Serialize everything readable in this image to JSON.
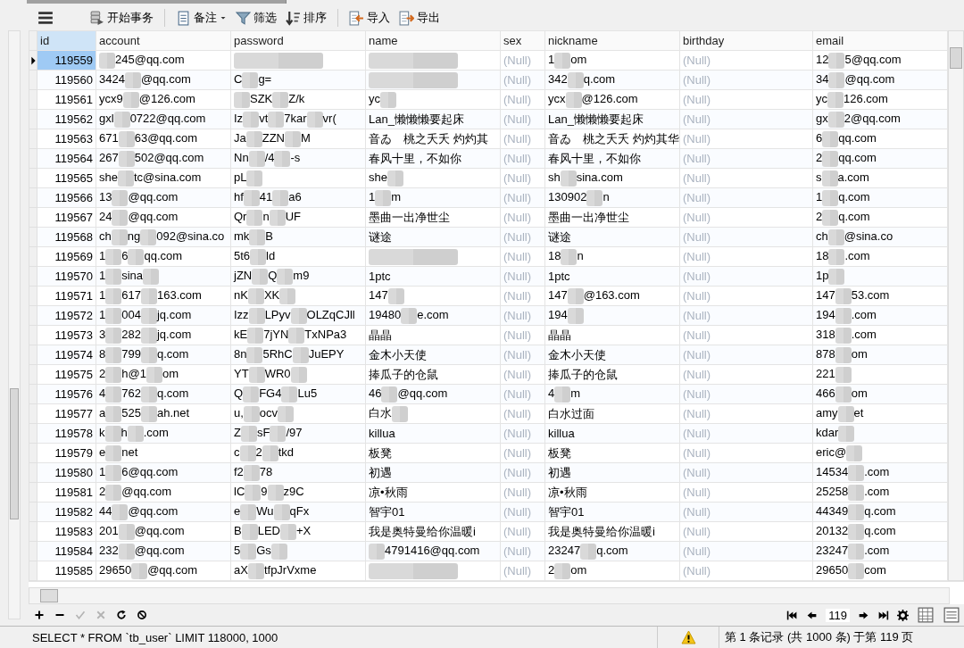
{
  "toolbar": {
    "buttons": [
      {
        "kind": "menu"
      },
      {
        "kind": "transaction",
        "label": "开始事务",
        "separator_after": true
      },
      {
        "kind": "note",
        "label": "备注",
        "dropdown": true
      },
      {
        "kind": "filter",
        "label": "筛选"
      },
      {
        "kind": "sort",
        "label": "排序",
        "separator_after": true
      },
      {
        "kind": "import",
        "label": "导入"
      },
      {
        "kind": "export",
        "label": "导出"
      }
    ]
  },
  "table": {
    "columns": [
      {
        "label": "id",
        "selected": true
      },
      {
        "label": "account",
        "selected": false
      },
      {
        "label": "password",
        "selected": false
      },
      {
        "label": "name",
        "selected": false
      },
      {
        "label": "sex",
        "selected": false
      },
      {
        "label": "nickname",
        "selected": false
      },
      {
        "label": "birthday",
        "selected": false
      },
      {
        "label": "email",
        "selected": false
      }
    ],
    "rows": [
      {
        "selected": true,
        "cells": [
          "119559",
          {
            "parts": [
              {
                "kind": "redaction"
              },
              "245@qq.com"
            ]
          },
          {
            "parts": [
              {
                "kind": "smudge"
              }
            ]
          },
          {
            "parts": [
              {
                "kind": "smudge"
              }
            ]
          },
          {
            "text": "(Null)",
            "null": true
          },
          {
            "parts": [
              "1",
              {
                "kind": "redaction"
              },
              "om"
            ]
          },
          {
            "text": "(Null)",
            "null": true
          },
          {
            "parts": [
              "12",
              {
                "kind": "redaction"
              },
              "5@qq.com"
            ]
          }
        ]
      },
      {
        "selected": false,
        "cells": [
          "119560",
          {
            "parts": [
              "3424",
              {
                "kind": "redaction"
              },
              "@qq.com"
            ]
          },
          {
            "parts": [
              "C",
              {
                "kind": "redaction"
              },
              "g="
            ]
          },
          {
            "parts": [
              {
                "kind": "smudge"
              }
            ]
          },
          {
            "text": "(Null)",
            "null": true
          },
          {
            "parts": [
              "342",
              {
                "kind": "redaction"
              },
              "q.com"
            ]
          },
          {
            "text": "(Null)",
            "null": true
          },
          {
            "parts": [
              "34",
              {
                "kind": "redaction"
              },
              "@qq.com"
            ]
          }
        ]
      },
      {
        "selected": false,
        "cells": [
          "119561",
          {
            "parts": [
              "ycx9",
              {
                "kind": "redaction"
              },
              "@126.com"
            ]
          },
          {
            "parts": [
              {
                "kind": "redaction"
              },
              "SZK",
              {
                "kind": "redaction"
              },
              "Z/k"
            ]
          },
          {
            "parts": [
              "yc",
              {
                "kind": "redaction"
              }
            ]
          },
          {
            "text": "(Null)",
            "null": true
          },
          {
            "parts": [
              "ycx",
              {
                "kind": "redaction"
              },
              "@126.com"
            ]
          },
          {
            "text": "(Null)",
            "null": true
          },
          {
            "parts": [
              "yc",
              {
                "kind": "redaction"
              },
              "126.com"
            ]
          }
        ]
      },
      {
        "selected": false,
        "cells": [
          "119562",
          {
            "parts": [
              "gxl",
              {
                "kind": "redaction"
              },
              "0722@qq.com"
            ]
          },
          {
            "parts": [
              "Iz",
              {
                "kind": "redaction"
              },
              "vt",
              {
                "kind": "redaction"
              },
              "7kar",
              {
                "kind": "redaction"
              },
              "vr("
            ]
          },
          "Lan_懒懒懒要起床",
          {
            "text": "(Null)",
            "null": true
          },
          "Lan_懒懒懒要起床",
          {
            "text": "(Null)",
            "null": true
          },
          {
            "parts": [
              "gx",
              {
                "kind": "redaction"
              },
              "2@qq.com"
            ]
          }
        ]
      },
      {
        "selected": false,
        "cells": [
          "119563",
          {
            "parts": [
              "671",
              {
                "kind": "redaction"
              },
              "63@qq.com"
            ]
          },
          {
            "parts": [
              "Ja",
              {
                "kind": "redaction"
              },
              "ZZN",
              {
                "kind": "redaction"
              },
              "M"
            ]
          },
          "音ゐ　桃之夭夭 灼灼其",
          {
            "text": "(Null)",
            "null": true
          },
          "音ゐ　桃之夭夭 灼灼其华",
          {
            "text": "(Null)",
            "null": true
          },
          {
            "parts": [
              "6",
              {
                "kind": "redaction"
              },
              "qq.com"
            ]
          }
        ]
      },
      {
        "selected": false,
        "cells": [
          "119564",
          {
            "parts": [
              "267",
              {
                "kind": "redaction"
              },
              "502@qq.com"
            ]
          },
          {
            "parts": [
              "Nn",
              {
                "kind": "redaction"
              },
              "/4",
              {
                "kind": "redaction"
              },
              "-s"
            ]
          },
          "春风十里，不如你",
          {
            "text": "(Null)",
            "null": true
          },
          "春风十里，不如你",
          {
            "text": "(Null)",
            "null": true
          },
          {
            "parts": [
              "2",
              {
                "kind": "redaction"
              },
              "qq.com"
            ]
          }
        ]
      },
      {
        "selected": false,
        "cells": [
          "119565",
          {
            "parts": [
              "she",
              {
                "kind": "redaction"
              },
              "tc@sina.com"
            ]
          },
          {
            "parts": [
              "pL",
              {
                "kind": "redaction"
              }
            ]
          },
          {
            "parts": [
              "she",
              {
                "kind": "redaction"
              }
            ]
          },
          {
            "text": "(Null)",
            "null": true
          },
          {
            "parts": [
              "sh",
              {
                "kind": "redaction"
              },
              "sina.com"
            ]
          },
          {
            "text": "(Null)",
            "null": true
          },
          {
            "parts": [
              "s",
              {
                "kind": "redaction"
              },
              "a.com"
            ]
          }
        ]
      },
      {
        "selected": false,
        "cells": [
          "119566",
          {
            "parts": [
              "13",
              {
                "kind": "redaction"
              },
              "@qq.com"
            ]
          },
          {
            "parts": [
              "hf",
              {
                "kind": "redaction"
              },
              "41",
              {
                "kind": "redaction"
              },
              "a6"
            ]
          },
          {
            "parts": [
              "1",
              {
                "kind": "redaction"
              },
              "m"
            ]
          },
          {
            "text": "(Null)",
            "null": true
          },
          {
            "parts": [
              "130902",
              {
                "kind": "redaction"
              },
              "n"
            ]
          },
          {
            "text": "(Null)",
            "null": true
          },
          {
            "parts": [
              "1",
              {
                "kind": "redaction"
              },
              "q.com"
            ]
          }
        ]
      },
      {
        "selected": false,
        "cells": [
          "119567",
          {
            "parts": [
              "24",
              {
                "kind": "redaction"
              },
              "@qq.com"
            ]
          },
          {
            "parts": [
              "Qr",
              {
                "kind": "redaction"
              },
              "n",
              {
                "kind": "redaction"
              },
              "UF"
            ]
          },
          "墨曲一出净世尘",
          {
            "text": "(Null)",
            "null": true
          },
          "墨曲一出净世尘",
          {
            "text": "(Null)",
            "null": true
          },
          {
            "parts": [
              "2",
              {
                "kind": "redaction"
              },
              "q.com"
            ]
          }
        ]
      },
      {
        "selected": false,
        "cells": [
          "119568",
          {
            "parts": [
              "ch",
              {
                "kind": "redaction"
              },
              "ng",
              {
                "kind": "redaction"
              },
              "092@sina.co"
            ]
          },
          {
            "parts": [
              "mk",
              {
                "kind": "redaction"
              },
              "B"
            ]
          },
          "谜途",
          {
            "text": "(Null)",
            "null": true
          },
          "谜途",
          {
            "text": "(Null)",
            "null": true
          },
          {
            "parts": [
              "ch",
              {
                "kind": "redaction"
              },
              "@sina.co"
            ]
          }
        ]
      },
      {
        "selected": false,
        "cells": [
          "119569",
          {
            "parts": [
              "1",
              {
                "kind": "redaction"
              },
              "6",
              {
                "kind": "redaction"
              },
              "qq.com"
            ]
          },
          {
            "parts": [
              "5t6",
              {
                "kind": "redaction"
              },
              "ld"
            ]
          },
          {
            "parts": [
              {
                "kind": "smudge"
              }
            ]
          },
          {
            "text": "(Null)",
            "null": true
          },
          {
            "parts": [
              "18",
              {
                "kind": "redaction"
              },
              "n"
            ]
          },
          {
            "text": "(Null)",
            "null": true
          },
          {
            "parts": [
              "18",
              {
                "kind": "redaction"
              },
              ".com"
            ]
          }
        ]
      },
      {
        "selected": false,
        "cells": [
          "119570",
          {
            "parts": [
              "1",
              {
                "kind": "redaction"
              },
              "sina",
              {
                "kind": "redaction"
              }
            ]
          },
          {
            "parts": [
              "jZN",
              {
                "kind": "redaction"
              },
              "Q",
              {
                "kind": "redaction"
              },
              "m9"
            ]
          },
          "1ptc",
          {
            "text": "(Null)",
            "null": true
          },
          "1ptc",
          {
            "text": "(Null)",
            "null": true
          },
          {
            "parts": [
              "1p",
              {
                "kind": "redaction"
              }
            ]
          }
        ]
      },
      {
        "selected": false,
        "cells": [
          "119571",
          {
            "parts": [
              "1",
              {
                "kind": "redaction"
              },
              "617",
              {
                "kind": "redaction"
              },
              "163.com"
            ]
          },
          {
            "parts": [
              "nK",
              {
                "kind": "redaction"
              },
              "XK",
              {
                "kind": "redaction"
              }
            ]
          },
          {
            "parts": [
              "147",
              {
                "kind": "redaction"
              }
            ]
          },
          {
            "text": "(Null)",
            "null": true
          },
          {
            "parts": [
              "147",
              {
                "kind": "redaction"
              },
              "@163.com"
            ]
          },
          {
            "text": "(Null)",
            "null": true
          },
          {
            "parts": [
              "147",
              {
                "kind": "redaction"
              },
              "53.com"
            ]
          }
        ]
      },
      {
        "selected": false,
        "cells": [
          "119572",
          {
            "parts": [
              "1",
              {
                "kind": "redaction"
              },
              "004",
              {
                "kind": "redaction"
              },
              "jq.com"
            ]
          },
          {
            "parts": [
              "Izz",
              {
                "kind": "redaction"
              },
              "LPyv",
              {
                "kind": "redaction"
              },
              "OLZqCJll"
            ]
          },
          {
            "parts": [
              "19480",
              {
                "kind": "redaction"
              },
              "e.com"
            ]
          },
          {
            "text": "(Null)",
            "null": true
          },
          {
            "parts": [
              "194",
              {
                "kind": "redaction"
              }
            ]
          },
          {
            "text": "(Null)",
            "null": true
          },
          {
            "parts": [
              "194",
              {
                "kind": "redaction"
              },
              ".com"
            ]
          }
        ]
      },
      {
        "selected": false,
        "cells": [
          "119573",
          {
            "parts": [
              "3",
              {
                "kind": "redaction"
              },
              "282",
              {
                "kind": "redaction"
              },
              "jq.com"
            ]
          },
          {
            "parts": [
              "kE",
              {
                "kind": "redaction"
              },
              "7jYN",
              {
                "kind": "redaction"
              },
              "TxNPa3"
            ]
          },
          "晶晶",
          {
            "text": "(Null)",
            "null": true
          },
          "晶晶",
          {
            "text": "(Null)",
            "null": true
          },
          {
            "parts": [
              "318",
              {
                "kind": "redaction"
              },
              ".com"
            ]
          }
        ]
      },
      {
        "selected": false,
        "cells": [
          "119574",
          {
            "parts": [
              "8",
              {
                "kind": "redaction"
              },
              "799",
              {
                "kind": "redaction"
              },
              "q.com"
            ]
          },
          {
            "parts": [
              "8n",
              {
                "kind": "redaction"
              },
              "5RhC",
              {
                "kind": "redaction"
              },
              "JuEPY"
            ]
          },
          "金木小天使",
          {
            "text": "(Null)",
            "null": true
          },
          "金木小天使",
          {
            "text": "(Null)",
            "null": true
          },
          {
            "parts": [
              "878",
              {
                "kind": "redaction"
              },
              "om"
            ]
          }
        ]
      },
      {
        "selected": false,
        "cells": [
          "119575",
          {
            "parts": [
              "2",
              {
                "kind": "redaction"
              },
              "h@1",
              {
                "kind": "redaction"
              },
              "om"
            ]
          },
          {
            "parts": [
              "YT",
              {
                "kind": "redaction"
              },
              "WR0",
              {
                "kind": "redaction"
              }
            ]
          },
          "捧瓜子的仓鼠",
          {
            "text": "(Null)",
            "null": true
          },
          "捧瓜子的仓鼠",
          {
            "text": "(Null)",
            "null": true
          },
          {
            "parts": [
              "221",
              {
                "kind": "redaction"
              }
            ]
          }
        ]
      },
      {
        "selected": false,
        "cells": [
          "119576",
          {
            "parts": [
              "4",
              {
                "kind": "redaction"
              },
              "762",
              {
                "kind": "redaction"
              },
              "q.com"
            ]
          },
          {
            "parts": [
              "Q",
              {
                "kind": "redaction"
              },
              "FG4",
              {
                "kind": "redaction"
              },
              "Lu5"
            ]
          },
          {
            "parts": [
              "46",
              {
                "kind": "redaction"
              },
              "@qq.com"
            ]
          },
          {
            "text": "(Null)",
            "null": true
          },
          {
            "parts": [
              "4",
              {
                "kind": "redaction"
              },
              "m"
            ]
          },
          {
            "text": "(Null)",
            "null": true
          },
          {
            "parts": [
              "466",
              {
                "kind": "redaction"
              },
              "om"
            ]
          }
        ]
      },
      {
        "selected": false,
        "cells": [
          "119577",
          {
            "parts": [
              "a",
              {
                "kind": "redaction"
              },
              "525",
              {
                "kind": "redaction"
              },
              "ah.net"
            ]
          },
          {
            "parts": [
              "u,",
              {
                "kind": "redaction"
              },
              "ocv",
              {
                "kind": "redaction"
              }
            ]
          },
          {
            "parts": [
              "白水",
              {
                "kind": "redaction"
              }
            ]
          },
          {
            "text": "(Null)",
            "null": true
          },
          "白水过面",
          {
            "text": "(Null)",
            "null": true
          },
          {
            "parts": [
              "amy",
              {
                "kind": "redaction"
              },
              "et"
            ]
          }
        ]
      },
      {
        "selected": false,
        "cells": [
          "119578",
          {
            "parts": [
              "k",
              {
                "kind": "redaction"
              },
              "h",
              {
                "kind": "redaction"
              },
              ".com"
            ]
          },
          {
            "parts": [
              "Z",
              {
                "kind": "redaction"
              },
              "sF",
              {
                "kind": "redaction"
              },
              "/97"
            ]
          },
          "killua",
          {
            "text": "(Null)",
            "null": true
          },
          "killua",
          {
            "text": "(Null)",
            "null": true
          },
          {
            "parts": [
              "kdar",
              {
                "kind": "redaction"
              }
            ]
          }
        ]
      },
      {
        "selected": false,
        "cells": [
          "119579",
          {
            "parts": [
              "e",
              {
                "kind": "redaction"
              },
              "net"
            ]
          },
          {
            "parts": [
              "c",
              {
                "kind": "redaction"
              },
              "2",
              {
                "kind": "redaction"
              },
              "tkd"
            ]
          },
          "板凳",
          {
            "text": "(Null)",
            "null": true
          },
          "板凳",
          {
            "text": "(Null)",
            "null": true
          },
          {
            "parts": [
              "eric@",
              {
                "kind": "redaction"
              }
            ]
          }
        ]
      },
      {
        "selected": false,
        "cells": [
          "119580",
          {
            "parts": [
              "1",
              {
                "kind": "redaction"
              },
              "6@qq.com"
            ]
          },
          {
            "parts": [
              "f2",
              {
                "kind": "redaction"
              },
              "78"
            ]
          },
          "初遇",
          {
            "text": "(Null)",
            "null": true
          },
          "初遇",
          {
            "text": "(Null)",
            "null": true
          },
          {
            "parts": [
              "14534",
              {
                "kind": "redaction"
              },
              ".com"
            ]
          }
        ]
      },
      {
        "selected": false,
        "cells": [
          "119581",
          {
            "parts": [
              "2",
              {
                "kind": "redaction"
              },
              "@qq.com"
            ]
          },
          {
            "parts": [
              "lC",
              {
                "kind": "redaction"
              },
              "9",
              {
                "kind": "redaction"
              },
              "z9C"
            ]
          },
          "凉•秋雨",
          {
            "text": "(Null)",
            "null": true
          },
          "凉•秋雨",
          {
            "text": "(Null)",
            "null": true
          },
          {
            "parts": [
              "25258",
              {
                "kind": "redaction"
              },
              ".com"
            ]
          }
        ]
      },
      {
        "selected": false,
        "cells": [
          "119582",
          {
            "parts": [
              "44",
              {
                "kind": "redaction"
              },
              "@qq.com"
            ]
          },
          {
            "parts": [
              "e",
              {
                "kind": "redaction"
              },
              "Wu",
              {
                "kind": "redaction"
              },
              "qFx"
            ]
          },
          "智宇01",
          {
            "text": "(Null)",
            "null": true
          },
          "智宇01",
          {
            "text": "(Null)",
            "null": true
          },
          {
            "parts": [
              "44349",
              {
                "kind": "redaction"
              },
              "q.com"
            ]
          }
        ]
      },
      {
        "selected": false,
        "cells": [
          "119583",
          {
            "parts": [
              "201",
              {
                "kind": "redaction"
              },
              "@qq.com"
            ]
          },
          {
            "parts": [
              "B",
              {
                "kind": "redaction"
              },
              "LED",
              {
                "kind": "redaction"
              },
              "+X"
            ]
          },
          "我是奥特曼给你温暖i",
          {
            "text": "(Null)",
            "null": true
          },
          "我是奥特曼给你温暖i",
          {
            "text": "(Null)",
            "null": true
          },
          {
            "parts": [
              "20132",
              {
                "kind": "redaction"
              },
              "q.com"
            ]
          }
        ]
      },
      {
        "selected": false,
        "cells": [
          "119584",
          {
            "parts": [
              "232",
              {
                "kind": "redaction"
              },
              "@qq.com"
            ]
          },
          {
            "parts": [
              "5",
              {
                "kind": "redaction"
              },
              "Gs",
              {
                "kind": "redaction"
              }
            ]
          },
          {
            "parts": [
              {
                "kind": "redaction"
              },
              "4791416@qq.com"
            ]
          },
          {
            "text": "(Null)",
            "null": true
          },
          {
            "parts": [
              "23247",
              {
                "kind": "redaction"
              },
              "q.com"
            ]
          },
          {
            "text": "(Null)",
            "null": true
          },
          {
            "parts": [
              "23247",
              {
                "kind": "redaction"
              },
              ".com"
            ]
          }
        ]
      },
      {
        "selected": false,
        "cells": [
          "119585",
          {
            "parts": [
              "29650",
              {
                "kind": "redaction"
              },
              "@qq.com"
            ]
          },
          {
            "parts": [
              "aX",
              {
                "kind": "redaction"
              },
              "tfpJrVxme"
            ]
          },
          {
            "parts": [
              {
                "kind": "smudge"
              }
            ]
          },
          {
            "text": "(Null)",
            "null": true
          },
          {
            "parts": [
              "2",
              {
                "kind": "redaction"
              },
              "om"
            ]
          },
          {
            "text": "(Null)",
            "null": true
          },
          {
            "parts": [
              "29650",
              {
                "kind": "redaction"
              },
              "com"
            ]
          }
        ]
      }
    ]
  },
  "record_toolbar": {
    "buttons": [
      {
        "kind": "add",
        "disabled": false
      },
      {
        "kind": "remove",
        "disabled": false
      },
      {
        "kind": "apply",
        "disabled": true
      },
      {
        "kind": "cancel",
        "disabled": true
      },
      {
        "kind": "refresh",
        "disabled": false
      },
      {
        "kind": "stop",
        "disabled": false
      }
    ],
    "pager": {
      "page": "119"
    }
  },
  "status_bar": {
    "sql": "SELECT * FROM `tb_user` LIMIT 118000, 1000",
    "warning": true,
    "record_info": "第 1 条记录 (共 1000 条) 于第 119 页"
  }
}
